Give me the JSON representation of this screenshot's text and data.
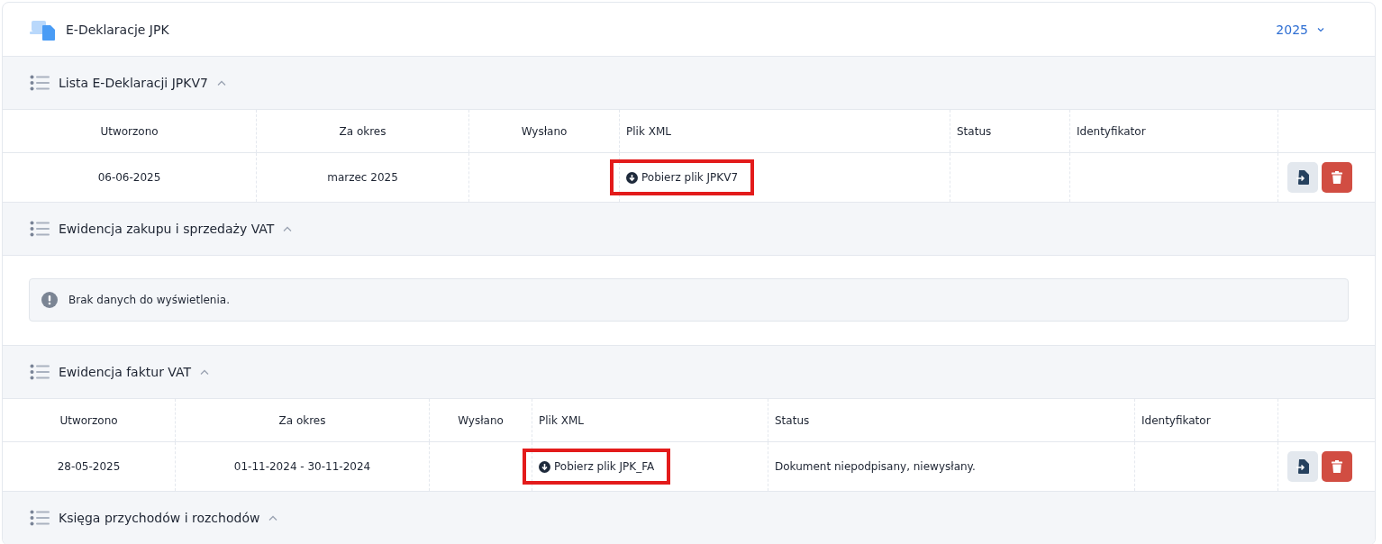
{
  "header": {
    "title": "E-Deklaracje JPK",
    "year": "2025"
  },
  "sections": [
    {
      "kind": "table",
      "title": "Lista E-Deklaracji JPKV7",
      "expanded": true,
      "columns": [
        "Utworzono",
        "Za okres",
        "Wysłano",
        "Plik XML",
        "Status",
        "Identyfikator"
      ],
      "rows": [
        {
          "created": "06-06-2025",
          "period": "marzec 2025",
          "sent": "",
          "file": "Pobierz plik JPKV7",
          "highlighted": true,
          "status": "",
          "identifier": ""
        }
      ]
    },
    {
      "kind": "empty",
      "title": "Ewidencja zakupu i sprzedaży VAT",
      "expanded": true,
      "message": "Brak danych do wyświetlenia."
    },
    {
      "kind": "table",
      "title": "Ewidencja faktur VAT",
      "expanded": true,
      "columns": [
        "Utworzono",
        "Za okres",
        "Wysłano",
        "Plik XML",
        "Status",
        "Identyfikator"
      ],
      "rows": [
        {
          "created": "28-05-2025",
          "period": "01-11-2024 - 30-11-2024",
          "sent": "",
          "file": "Pobierz plik JPK_FA",
          "highlighted": true,
          "status": "Dokument niepodpisany, niewysłany.",
          "identifier": ""
        }
      ]
    },
    {
      "kind": "none",
      "title": "Księga przychodów i rozchodów",
      "expanded": true
    }
  ]
}
